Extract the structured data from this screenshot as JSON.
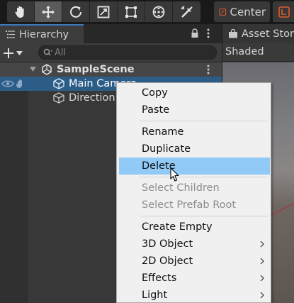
{
  "toolbar": {
    "tools": [
      {
        "icon": "hand-icon",
        "active": false
      },
      {
        "icon": "move-icon",
        "active": true
      },
      {
        "icon": "rotate-icon",
        "active": false
      },
      {
        "icon": "scale-icon",
        "active": false
      },
      {
        "icon": "rect-icon",
        "active": false
      },
      {
        "icon": "transform-icon",
        "active": false
      },
      {
        "icon": "custom-tool-icon",
        "active": false
      }
    ],
    "pivot_label": "Center",
    "pivot_icon": "pivot-center-icon",
    "space_icon": "local-space-icon"
  },
  "hierarchy": {
    "tab_label": "Hierarchy",
    "search_placeholder": "All",
    "scene_name": "SampleScene",
    "objects": [
      {
        "name": "Main Camera",
        "selected": true
      },
      {
        "name": "Direction",
        "selected": false
      }
    ]
  },
  "scene_panel": {
    "tab_label": "Asset Stor",
    "draw_mode": "Shaded"
  },
  "context_menu": {
    "items": [
      {
        "label": "Copy",
        "disabled": false,
        "highlighted": false,
        "submenu": false
      },
      {
        "label": "Paste",
        "disabled": false,
        "highlighted": false,
        "submenu": false
      },
      {
        "label": "Rename",
        "disabled": false,
        "highlighted": false,
        "submenu": false
      },
      {
        "label": "Duplicate",
        "disabled": false,
        "highlighted": false,
        "submenu": false
      },
      {
        "label": "Delete",
        "disabled": false,
        "highlighted": true,
        "submenu": false
      },
      {
        "label": "Select Children",
        "disabled": true,
        "highlighted": false,
        "submenu": false
      },
      {
        "label": "Select Prefab Root",
        "disabled": true,
        "highlighted": false,
        "submenu": false
      },
      {
        "label": "Create Empty",
        "disabled": false,
        "highlighted": false,
        "submenu": false
      },
      {
        "label": "3D Object",
        "disabled": false,
        "highlighted": false,
        "submenu": true
      },
      {
        "label": "2D Object",
        "disabled": false,
        "highlighted": false,
        "submenu": true
      },
      {
        "label": "Effects",
        "disabled": false,
        "highlighted": false,
        "submenu": true
      },
      {
        "label": "Light",
        "disabled": false,
        "highlighted": false,
        "submenu": true
      }
    ]
  },
  "colors": {
    "selection": "#2c5d87",
    "menu_highlight": "#91c9f7",
    "active_tab_accent": "#3a79bb"
  }
}
